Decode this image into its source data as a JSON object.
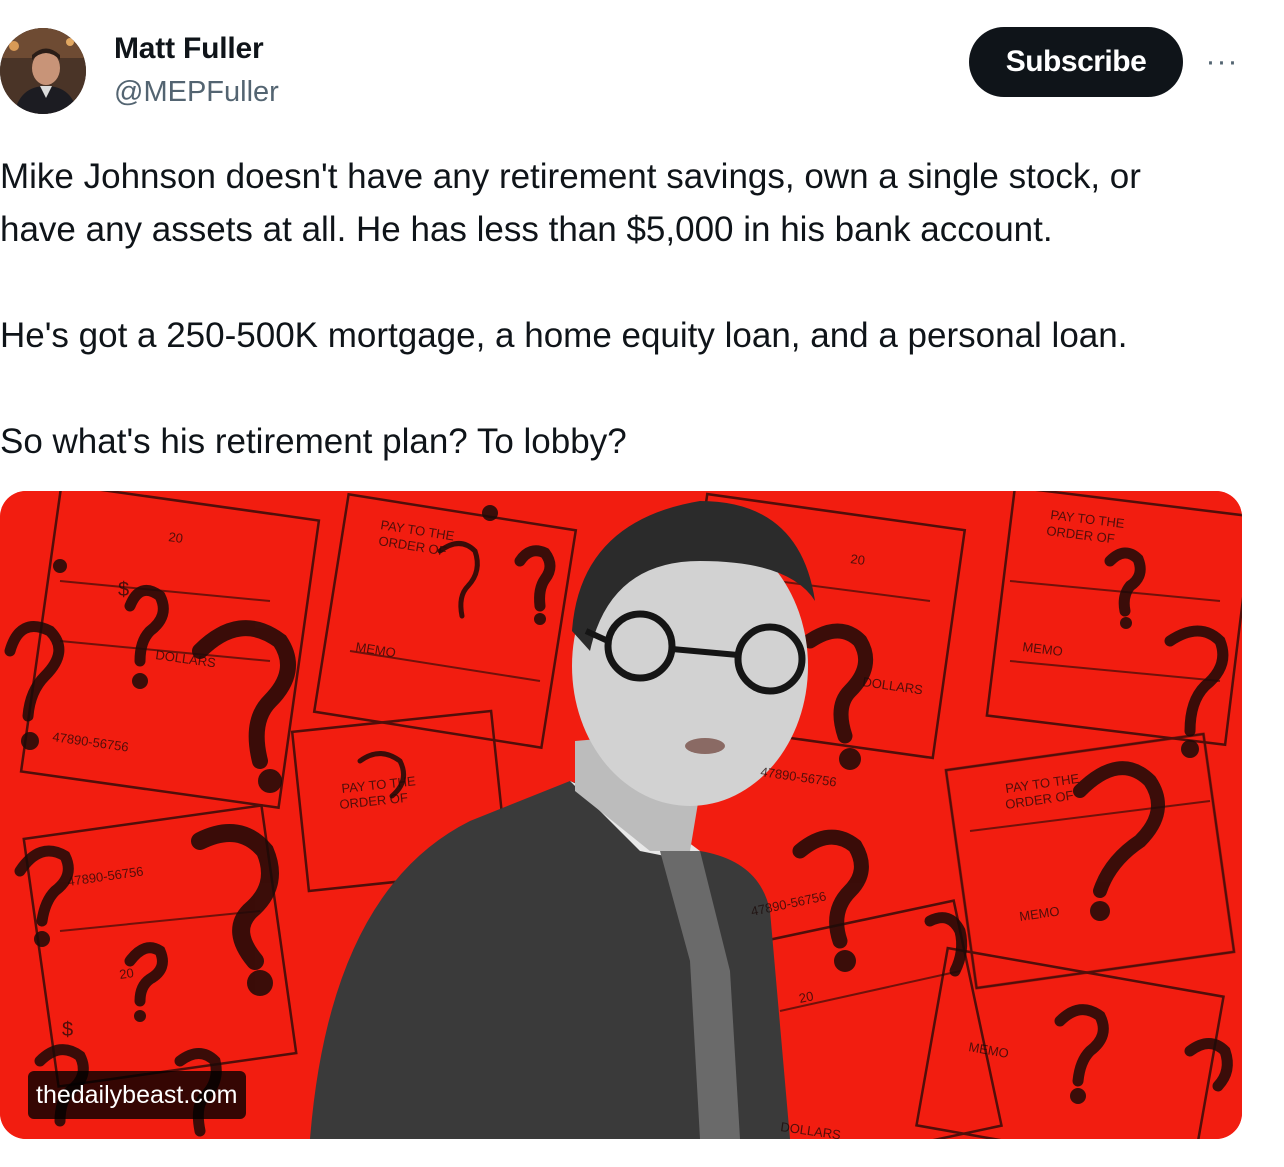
{
  "author": {
    "name": "Matt Fuller",
    "handle": "@MEPFuller"
  },
  "actions": {
    "subscribe_label": "Subscribe",
    "more_label": "···"
  },
  "tweet": {
    "paragraphs": [
      "Mike Johnson doesn't have any retirement savings, own a single stock, or",
      "have any assets at all. He has less than $5,000 in his bank account.",
      "He's got a 250-500K mortgage, a home equity loan, and a personal loan.",
      "So what's his retirement plan? To lobby?"
    ]
  },
  "media": {
    "source": "thedailybeast.com",
    "check_texts": {
      "pay_to_order": [
        "PAY TO THE",
        "ORDER OF"
      ],
      "memo": "MEMO",
      "dollars": "DOLLARS",
      "dollar_sign": "$",
      "date_mark": "20",
      "account_number": "47890-56756"
    }
  },
  "colors": {
    "accent": "#0f1419",
    "handle": "#536471",
    "media_background": "#f21d10"
  },
  "icons": [
    "avatar",
    "more-icon",
    "question-mark-icon"
  ]
}
